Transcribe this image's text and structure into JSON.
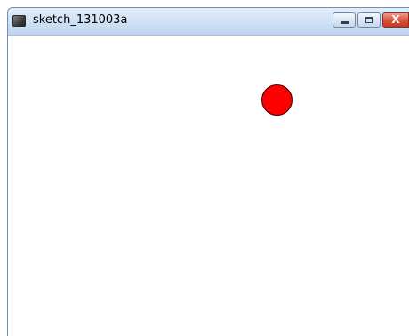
{
  "window": {
    "title": "sketch_131003a",
    "app_icon": "processing-sketch-icon",
    "buttons": {
      "minimize_icon": "minimize-icon",
      "maximize_icon": "maximize-icon",
      "close_icon": "close-icon",
      "close_label": "X"
    }
  },
  "canvas": {
    "background": "#ffffff",
    "shapes": [
      {
        "kind": "circle",
        "fill": "#ff0000",
        "stroke": "#3a0000"
      }
    ]
  }
}
